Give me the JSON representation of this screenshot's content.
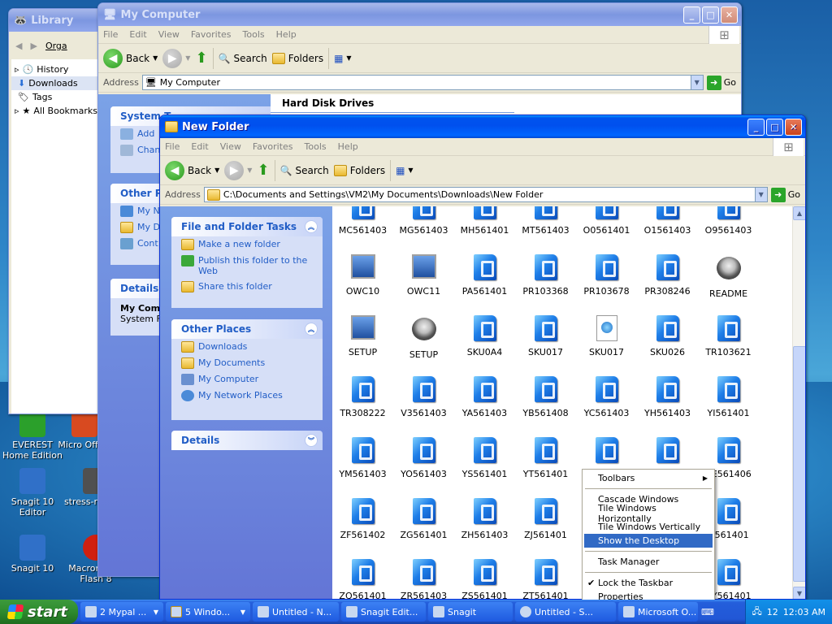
{
  "desktop": {
    "icons": [
      {
        "label": "EVEREST Home Edition",
        "color": "#2ba02b"
      },
      {
        "label": "Micro Office",
        "color": "#d84a20"
      },
      {
        "label": "Snagit 10 Editor",
        "color": "#3070c8"
      },
      {
        "label": "stress-reduc...",
        "color": "#505050"
      },
      {
        "label": "Snagit 10",
        "color": "#3070c8"
      },
      {
        "label": "Macromedia Flash 8",
        "color": "#d02010"
      }
    ]
  },
  "library": {
    "title": "Library",
    "org": "Orga",
    "items": [
      "History",
      "Downloads",
      "Tags",
      "All Bookmarks"
    ]
  },
  "mycomputer": {
    "title": "My Computer",
    "menu": [
      "File",
      "Edit",
      "View",
      "Favorites",
      "Tools",
      "Help"
    ],
    "back": "Back",
    "search": "Search",
    "folders": "Folders",
    "address_label": "Address",
    "address": "My Computer",
    "go": "Go",
    "system_head": "System T",
    "links": [
      "Add",
      "Chan"
    ],
    "other_head": "Other Pl",
    "other_links": [
      "My N",
      "My D",
      "Cont"
    ],
    "details_head": "Details",
    "details_name": "My Com",
    "details_sub": "System F",
    "section": "Hard Disk Drives"
  },
  "newfolder": {
    "title": "New Folder",
    "menu": [
      "File",
      "Edit",
      "View",
      "Favorites",
      "Tools",
      "Help"
    ],
    "back": "Back",
    "search": "Search",
    "folders": "Folders",
    "address_label": "Address",
    "address": "C:\\Documents and Settings\\VM2\\My Documents\\Downloads\\New Folder",
    "go": "Go",
    "tasks_head": "File and Folder Tasks",
    "tasks": [
      "Make a new folder",
      "Publish this folder to the Web",
      "Share this folder"
    ],
    "places_head": "Other Places",
    "places": [
      "Downloads",
      "My Documents",
      "My Computer",
      "My Network Places"
    ],
    "details_head": "Details",
    "files": [
      [
        "MC561403",
        "MG561403",
        "MH561401",
        "MT561403",
        "O0561401",
        "O1561403",
        "O9561403"
      ],
      [
        "OWC10",
        "OWC11",
        "PA561401",
        "PR103368",
        "PR103678",
        "PR308246",
        "README"
      ],
      [
        "SETUP",
        "SETUP",
        "SKU0A4",
        "SKU017",
        "SKU017",
        "SKU026",
        "TR103621"
      ],
      [
        "TR308222",
        "V3561403",
        "YA561403",
        "YB561408",
        "YC561403",
        "YH561403",
        "YI561401"
      ],
      [
        "YM561403",
        "YO561403",
        "YS561401",
        "YT561401",
        "ZC561402",
        "ZD561402",
        "ZE561406"
      ],
      [
        "ZF561402",
        "ZG561401",
        "ZH561403",
        "ZJ561401",
        "",
        "",
        "N561401"
      ],
      [
        "ZQ561401",
        "ZR561403",
        "ZS561401",
        "ZT561401",
        "",
        "",
        "ZY561401"
      ]
    ]
  },
  "context_menu": {
    "items": [
      "Toolbars",
      "Cascade Windows",
      "Tile Windows Horizontally",
      "Tile Windows Vertically",
      "Show the Desktop",
      "Task Manager",
      "Lock the Taskbar",
      "Properties"
    ]
  },
  "taskbar": {
    "start": "start",
    "tasks": [
      "2 Mypal ...",
      "5 Windo...",
      "Untitled - N...",
      "Snagit Edit...",
      "Snagit",
      "Untitled - S...",
      "Microsoft O..."
    ],
    "time": "12:03 AM",
    "badge": "12"
  }
}
